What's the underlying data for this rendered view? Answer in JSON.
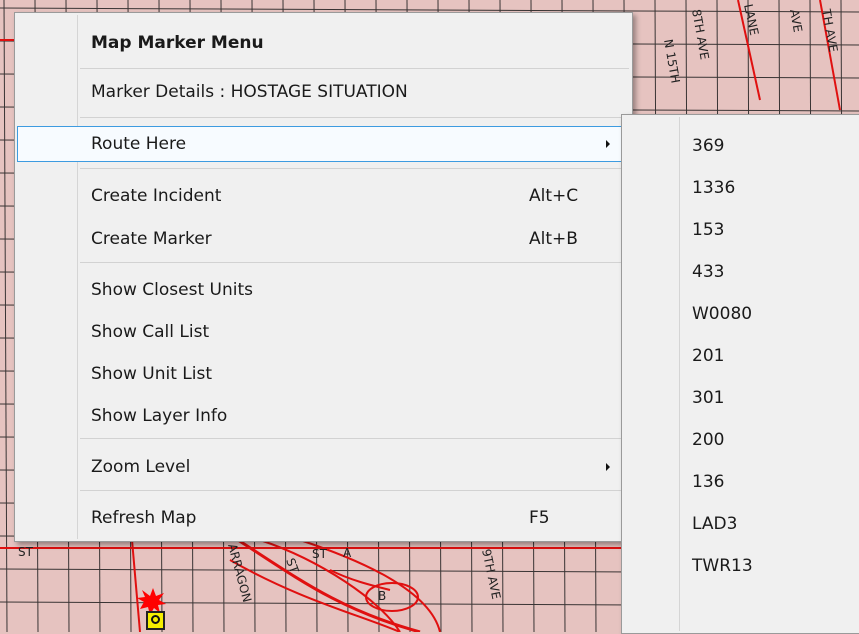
{
  "menu": {
    "title": "Map Marker Menu",
    "items": [
      {
        "label": "Marker Details : HOSTAGE SITUATION",
        "shortcut": ""
      },
      {
        "label": "Route Here",
        "shortcut": ""
      },
      {
        "label": "Create Incident",
        "shortcut": "Alt+C"
      },
      {
        "label": "Create Marker",
        "shortcut": "Alt+B"
      },
      {
        "label": "Show Closest Units",
        "shortcut": ""
      },
      {
        "label": "Show Call List",
        "shortcut": ""
      },
      {
        "label": "Show Unit List",
        "shortcut": ""
      },
      {
        "label": "Show Layer Info",
        "shortcut": ""
      },
      {
        "label": "Zoom Level",
        "shortcut": ""
      },
      {
        "label": "Refresh Map",
        "shortcut": "F5"
      }
    ]
  },
  "route_submenu": {
    "units": [
      "369",
      "1336",
      "153",
      "433",
      "W0080",
      "201",
      "301",
      "200",
      "136",
      "LAD3",
      "TWR13"
    ]
  },
  "map": {
    "street_labels": [
      "8TH AVE",
      "LANE",
      "AVE",
      "N 15TH",
      "ST",
      "ST",
      "A",
      "B",
      "9TH AVE",
      "ARRAGON",
      "ST",
      "TH AVE"
    ]
  },
  "colors": {
    "map_background": "#e6c3c0",
    "road_red": "#e01010",
    "menu_background": "#f0f0f0",
    "highlight_border": "#3d9be0",
    "incident_star": "#ff0000",
    "unit_marker": "#f5ee00"
  }
}
